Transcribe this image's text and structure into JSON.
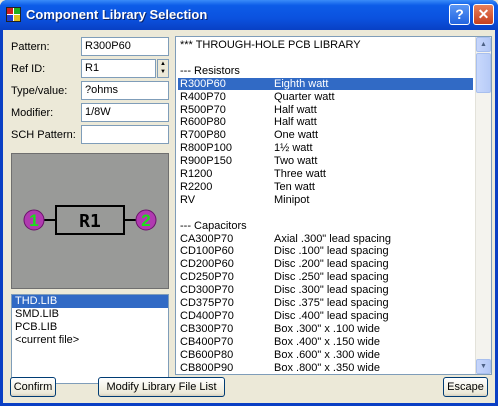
{
  "window": {
    "title": "Component Library Selection",
    "help_glyph": "?",
    "close_glyph": "✕"
  },
  "form": {
    "pattern_label": "Pattern:",
    "pattern_value": "R300P60",
    "refid_label": "Ref ID:",
    "refid_value": "R1",
    "type_label": "Type/value:",
    "type_value": "?ohms",
    "modifier_label": "Modifier:",
    "modifier_value": "1/8W",
    "sch_label": "SCH Pattern:",
    "sch_value": ""
  },
  "preview": {
    "ref_text": "R1",
    "pin1": "1",
    "pin2": "2"
  },
  "libraries": {
    "items": [
      "THD.LIB",
      "SMD.LIB",
      "PCB.LIB",
      "<current file>"
    ],
    "selected_index": 0
  },
  "parts": {
    "selected_index": 3,
    "rows": [
      {
        "name": "*** THROUGH-HOLE PCB LIBRARY",
        "desc": ""
      },
      {
        "name": "",
        "desc": ""
      },
      {
        "name": "--- Resistors",
        "desc": ""
      },
      {
        "name": "R300P60",
        "desc": "Eighth watt"
      },
      {
        "name": "R400P70",
        "desc": "Quarter watt"
      },
      {
        "name": "R500P70",
        "desc": "Half watt"
      },
      {
        "name": "R600P80",
        "desc": "Half watt"
      },
      {
        "name": "R700P80",
        "desc": "One watt"
      },
      {
        "name": "R800P100",
        "desc": "1½ watt"
      },
      {
        "name": "R900P150",
        "desc": "Two watt"
      },
      {
        "name": "R1200",
        "desc": "Three watt"
      },
      {
        "name": "R2200",
        "desc": "Ten watt"
      },
      {
        "name": "RV",
        "desc": "Minipot"
      },
      {
        "name": "",
        "desc": ""
      },
      {
        "name": "--- Capacitors",
        "desc": ""
      },
      {
        "name": "CA300P70",
        "desc": "Axial .300\" lead spacing"
      },
      {
        "name": "CD100P60",
        "desc": "Disc .100\" lead spacing"
      },
      {
        "name": "CD200P60",
        "desc": "Disc .200\" lead spacing"
      },
      {
        "name": "CD250P70",
        "desc": "Disc .250\" lead spacing"
      },
      {
        "name": "CD300P70",
        "desc": "Disc .300\" lead spacing"
      },
      {
        "name": "CD375P70",
        "desc": "Disc .375\" lead spacing"
      },
      {
        "name": "CD400P70",
        "desc": "Disc .400\" lead spacing"
      },
      {
        "name": "CB300P70",
        "desc": "Box .300\" x .100 wide"
      },
      {
        "name": "CB400P70",
        "desc": "Box .400\" x .150 wide"
      },
      {
        "name": "CB600P80",
        "desc": "Box .600\" x .300 wide"
      },
      {
        "name": "CB800P90",
        "desc": "Box .800\" x .350 wide"
      }
    ]
  },
  "buttons": {
    "confirm": "Confirm",
    "modify": "Modify Library File List",
    "escape": "Escape"
  },
  "colors": {
    "selection": "#316ac5",
    "preview_bg": "#999a98",
    "pin_fill": "#b03ab0",
    "pin_text": "#19e019"
  }
}
